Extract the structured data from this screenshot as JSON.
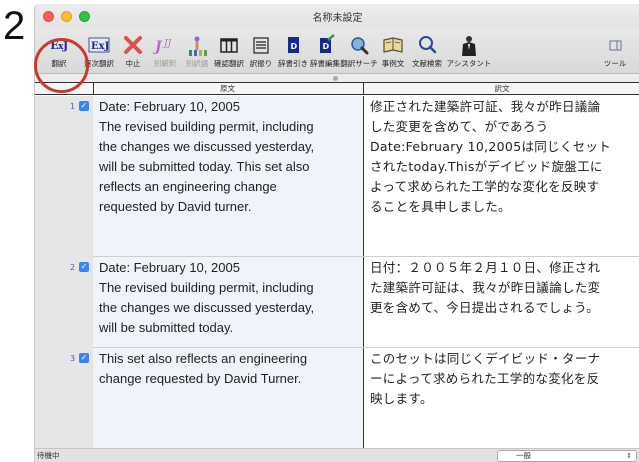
{
  "step_number": "2",
  "window": {
    "title": "名称未設定"
  },
  "toolbar": {
    "items": [
      {
        "label": "翻訳",
        "icon": "ej-logo-icon"
      },
      {
        "label": "逐次翻訳",
        "icon": "ej-logo-icon"
      },
      {
        "label": "中止",
        "icon": "cancel-x-icon"
      },
      {
        "label": "別解釈",
        "icon": "alt-interpret-icon"
      },
      {
        "label": "別訳語",
        "icon": "alt-word-icon"
      },
      {
        "label": "確認翻訳",
        "icon": "columns-icon"
      },
      {
        "label": "訳振り",
        "icon": "lines-icon"
      },
      {
        "label": "辞書引き",
        "icon": "dictionary-icon"
      },
      {
        "label": "辞書編集",
        "icon": "dictionary-edit-icon"
      },
      {
        "label": "翻訳サーチ",
        "icon": "translation-search-icon"
      },
      {
        "label": "事例文",
        "icon": "example-book-icon"
      },
      {
        "label": "文献検索",
        "icon": "magnifier-icon"
      },
      {
        "label": "アシスタント",
        "icon": "assistant-icon"
      },
      {
        "label": "ツール",
        "icon": "tool-icon"
      }
    ],
    "highlighted_item": "翻訳"
  },
  "columns": {
    "source": "原文",
    "target": "訳文"
  },
  "rows": [
    {
      "number": "1",
      "checked": true,
      "source": "Date: February 10, 2005\nThe revised building permit, including\nthe changes we discussed yesterday,\nwill be submitted today. This set also\nreflects an engineering change\nrequested by David turner.",
      "target": "修正された建築許可証、我々が昨日議論\nした変更を含めて、がであろう\nDate:February 10,2005は同じくセット\nされたtoday.Thisがデイビッド旋盤工に\nよって求められた工学的な変化を反映す\nることを具申しました。"
    },
    {
      "number": "2",
      "checked": true,
      "source": "Date: February 10, 2005\nThe revised building permit, including\nthe changes we discussed yesterday,\nwill be submitted today.",
      "target": "日付：２００５年２月１０日、修正され\nた建築許可証は、我々が昨日議論した変\n更を含めて、今日提出されるでしょう。"
    },
    {
      "number": "3",
      "checked": true,
      "source": "This set also reflects an engineering\nchange requested by David Turner.",
      "target": "このセットは同じくデイビッド・ターナ\nーによって求められた工学的な変化を反\n映します。"
    }
  ],
  "status": {
    "text": "待機中",
    "mode": "一般"
  },
  "colors": {
    "highlight": "#c8392b",
    "check": "#3b82f6",
    "source_bg": "#f0f3fa"
  }
}
